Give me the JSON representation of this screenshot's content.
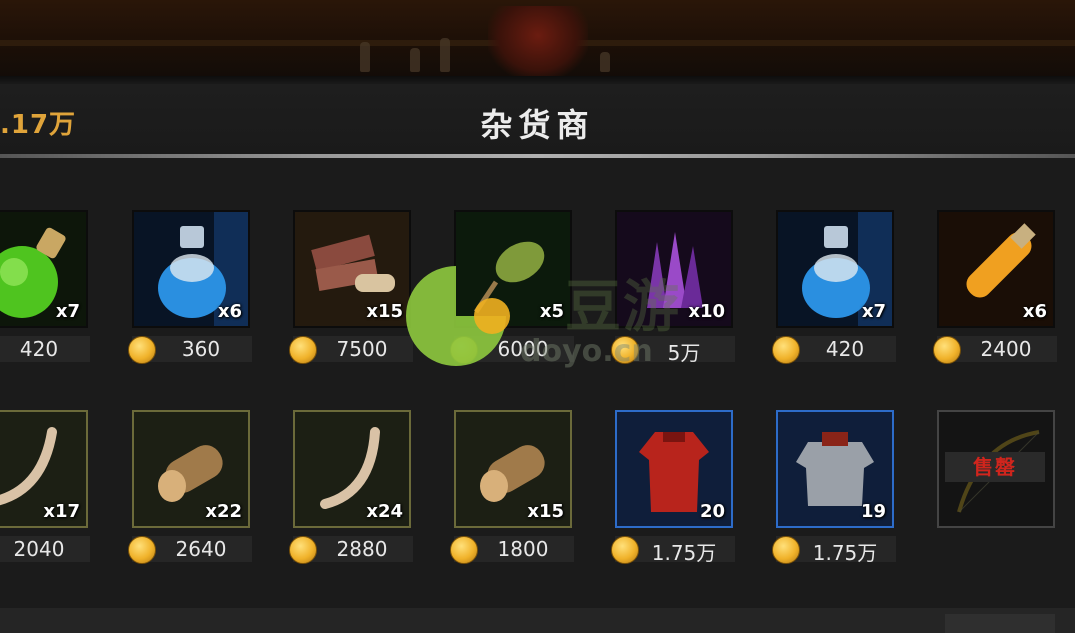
{
  "header": {
    "currency_amount": ".17万",
    "title": "杂货商"
  },
  "shop": {
    "row1": [
      {
        "icon": "green-potion-icon",
        "qty": "x7",
        "price": "420"
      },
      {
        "icon": "blue-potion-icon",
        "qty": "x6",
        "price": "360"
      },
      {
        "icon": "books-scroll-icon",
        "qty": "x15",
        "price": "7500"
      },
      {
        "icon": "seed-pod-icon",
        "qty": "x5",
        "price": "6000"
      },
      {
        "icon": "purple-crystal-icon",
        "qty": "x10",
        "price": "5万"
      },
      {
        "icon": "blue-potion-icon",
        "qty": "x7",
        "price": "420"
      },
      {
        "icon": "orange-vial-icon",
        "qty": "x6",
        "price": "2400"
      }
    ],
    "row2": [
      {
        "icon": "horn-icon",
        "qty": "x17",
        "price": "2040",
        "frame": "gold"
      },
      {
        "icon": "wood-log-icon",
        "qty": "x22",
        "price": "2640",
        "frame": "gold"
      },
      {
        "icon": "horn-icon",
        "qty": "x24",
        "price": "2880",
        "frame": "gold"
      },
      {
        "icon": "wood-log-icon",
        "qty": "x15",
        "price": "1800",
        "frame": "gold"
      },
      {
        "icon": "red-tunic-icon",
        "qty": "20",
        "price": "1.75万",
        "frame": "blue"
      },
      {
        "icon": "steel-armor-icon",
        "qty": "19",
        "price": "1.75万",
        "frame": "blue"
      }
    ],
    "sold_item": {
      "icon": "bow-icon",
      "label": "售罄"
    }
  },
  "watermark": {
    "text": "豆游",
    "url": "doyo.cn"
  },
  "colors": {
    "currency_gold": "#e0a43a",
    "frame_gold": "#6b6a3a",
    "frame_blue": "#2d6cc9",
    "sold_out_red": "#d0251d"
  }
}
